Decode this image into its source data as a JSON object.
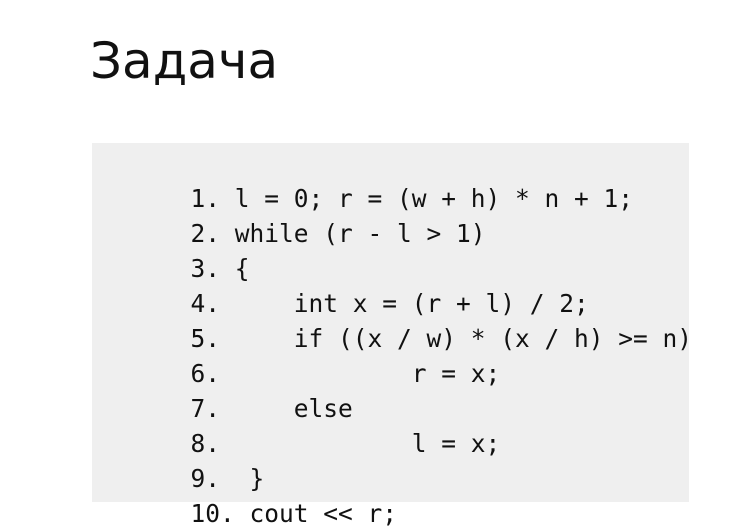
{
  "title": "Задача",
  "code": {
    "lines": [
      {
        "num": "1.",
        "text": "l = 0; r = (w + h) * n + 1;"
      },
      {
        "num": "2.",
        "text": "while (r - l > 1)"
      },
      {
        "num": "3.",
        "text": "{"
      },
      {
        "num": "4.",
        "text": "    int x = (r + l) / 2;"
      },
      {
        "num": "5.",
        "text": "    if ((x / w) * (x / h) >= n)"
      },
      {
        "num": "6.",
        "text": "            r = x;"
      },
      {
        "num": "7.",
        "text": "    else"
      },
      {
        "num": "8.",
        "text": "            l = x;"
      },
      {
        "num": "9.",
        "text": " }"
      },
      {
        "num": "10.",
        "text": "cout << r;"
      }
    ]
  }
}
